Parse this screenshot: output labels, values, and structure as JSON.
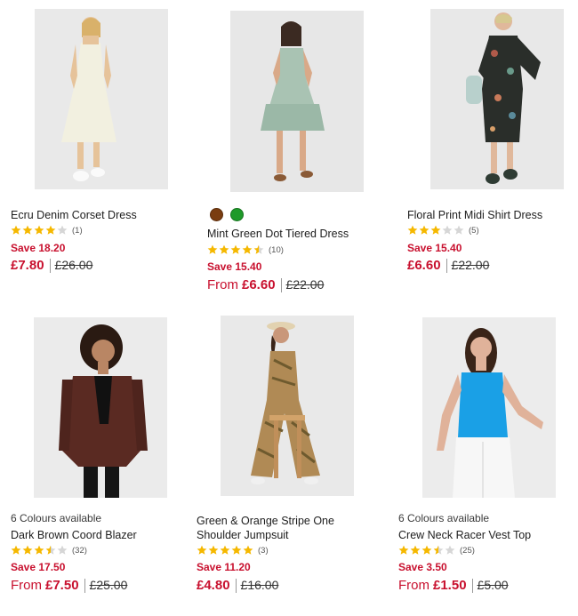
{
  "colors": {
    "sale": "#c8102e",
    "star": "#f5b800",
    "star_empty": "#d6d6d6"
  },
  "products": [
    {
      "title": "Ecru Denim Corset Dress",
      "rating": 4,
      "reviews": "(1)",
      "save": "Save 18.20",
      "from": "",
      "price": "£7.80",
      "was": "£26.00",
      "colours": "",
      "swatches": []
    },
    {
      "title": "Mint Green Dot Tiered Dress",
      "rating": 4.5,
      "reviews": "(10)",
      "save": "Save 15.40",
      "from": "From",
      "price": "£6.60",
      "was": "£22.00",
      "colours": "",
      "swatches": [
        "#7a3d10",
        "#1f9a2a"
      ]
    },
    {
      "title": "Floral Print Midi Shirt Dress",
      "rating": 3,
      "reviews": "(5)",
      "save": "Save 15.40",
      "from": "",
      "price": "£6.60",
      "was": "£22.00",
      "colours": "",
      "swatches": []
    },
    {
      "title": "Dark Brown Coord Blazer",
      "rating": 3.5,
      "reviews": "(32)",
      "save": "Save 17.50",
      "from": "From",
      "price": "£7.50",
      "was": "£25.00",
      "colours": "6 Colours available",
      "swatches": []
    },
    {
      "title": "Green & Orange Stripe One Shoulder Jumpsuit",
      "rating": 5,
      "reviews": "(3)",
      "save": "Save 11.20",
      "from": "",
      "price": "£4.80",
      "was": "£16.00",
      "colours": "",
      "swatches": []
    },
    {
      "title": "Crew Neck Racer Vest Top",
      "rating": 3.5,
      "reviews": "(25)",
      "save": "Save 3.50",
      "from": "From",
      "price": "£1.50",
      "was": "£5.00",
      "colours": "6 Colours available",
      "swatches": []
    }
  ]
}
